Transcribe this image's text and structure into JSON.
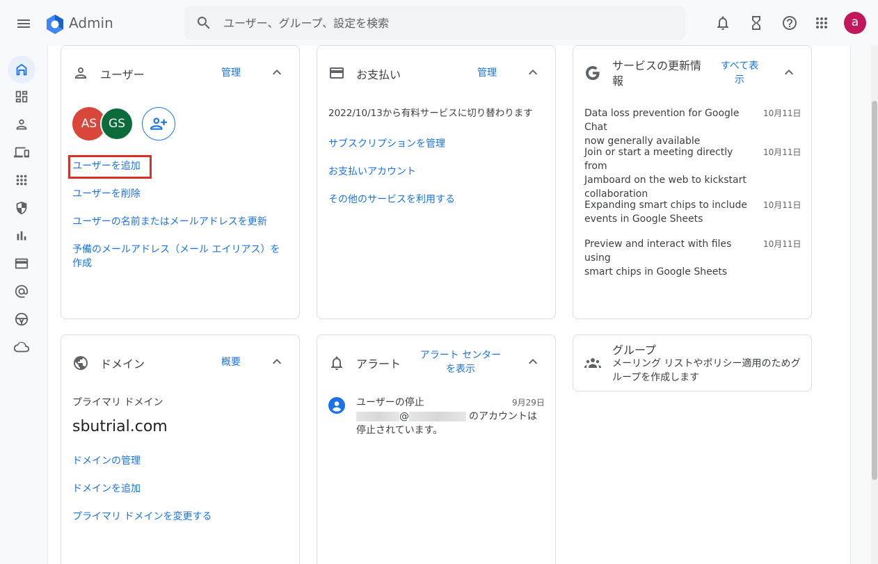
{
  "app": {
    "title": "Admin"
  },
  "search": {
    "placeholder": "ユーザー、グループ、設定を検索"
  },
  "account": {
    "initial": "a"
  },
  "users_card": {
    "title": "ユーザー",
    "action": "管理",
    "avatars": [
      {
        "initials": "AS",
        "color": "#d9473a"
      },
      {
        "initials": "GS",
        "color": "#0b6b3a"
      }
    ],
    "links": [
      "ユーザーを追加",
      "ユーザーを削除",
      "ユーザーの名前またはメールアドレスを更新",
      "予備のメールアドレス（メール エイリアス）を",
      "作成"
    ]
  },
  "billing_card": {
    "title": "お支払い",
    "action": "管理",
    "status": "2022/10/13から有料サービスに切り替わります",
    "links": [
      "サブスクリプションを管理",
      "お支払いアカウント",
      "その他のサービスを利用する"
    ]
  },
  "updates_card": {
    "title_line1": "サービスの更新情",
    "title_line2": "報",
    "action_line1": "すべて表",
    "action_line2": "示",
    "items": [
      {
        "title_line1": "Data loss prevention for Google Chat",
        "title_line2": "now generally available",
        "title_line3": "",
        "date": "10月11日"
      },
      {
        "title_line1": "Join or start a meeting directly from",
        "title_line2": "Jamboard on the web to kickstart",
        "title_line3": "collaboration",
        "date": "10月11日"
      },
      {
        "title_line1": "Expanding smart chips to include",
        "title_line2": "events in Google Sheets",
        "title_line3": "",
        "date": "10月11日"
      },
      {
        "title_line1": "Preview and interact with files using",
        "title_line2": "smart chips in Google Sheets",
        "title_line3": "",
        "date": "10月11日"
      }
    ]
  },
  "domain_card": {
    "title": "ドメイン",
    "action": "概要",
    "label": "プライマリ ドメイン",
    "domain": "sbutrial.com",
    "links": [
      "ドメインの管理",
      "ドメインを追加",
      "プライマリ ドメインを変更する"
    ]
  },
  "alerts_card": {
    "title": "アラート",
    "action_line1": "アラート センター",
    "action_line2": "を表示",
    "alert_title": "ユーザーの停止",
    "alert_date": "9月29日",
    "alert_at": "@",
    "alert_text1": "のアカウントは",
    "alert_text2": "停止されています。"
  },
  "groups_card": {
    "title": "グループ",
    "desc_line1": "メーリング リストやポリシー適用のためグ",
    "desc_line2": "ループを作成します"
  },
  "rail": {
    "items": [
      "home-icon",
      "dashboard-icon",
      "user-icon",
      "devices-icon",
      "apps-icon",
      "security-icon",
      "reports-icon",
      "billing-icon",
      "account-at-icon",
      "rules-icon",
      "storage-cloud-icon"
    ]
  },
  "colors": {
    "accent": "#1a73e8",
    "highlight": "#d93025"
  }
}
